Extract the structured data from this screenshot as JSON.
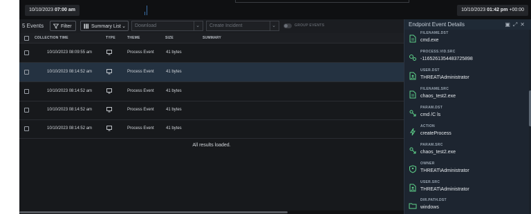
{
  "timeline": {
    "start_date": "10/10/2023",
    "start_time": "07:00 am",
    "end_date": "10/10/2023",
    "end_time": "01:42 pm",
    "end_tz": "+00:00"
  },
  "toolbar": {
    "count": "5 Events",
    "filter_label": "Filter",
    "view_label": "Summary List",
    "download_placeholder": "Download",
    "incident_placeholder": "Create Incident",
    "group_events_label": "GROUP EVENTS"
  },
  "table": {
    "columns": [
      "COLLECTION TIME",
      "TYPE",
      "THEME",
      "SIZE",
      "SUMMARY"
    ],
    "rows": [
      {
        "time": "10/10/2023 08:09:55 am",
        "theme": "Process Event",
        "size": "41 bytes"
      },
      {
        "time": "10/10/2023 08:14:52 am",
        "theme": "Process Event",
        "size": "41 bytes"
      },
      {
        "time": "10/10/2023 08:14:52 am",
        "theme": "Process Event",
        "size": "41 bytes"
      },
      {
        "time": "10/10/2023 08:14:52 am",
        "theme": "Process Event",
        "size": "41 bytes"
      },
      {
        "time": "10/10/2023 08:14:52 am",
        "theme": "Process Event",
        "size": "41 bytes"
      }
    ],
    "selected_row": 1,
    "status": "All results loaded."
  },
  "panel": {
    "title": "Endpoint Event Details",
    "properties": [
      {
        "key": "FILENAME.DST",
        "value": "cmd.exe",
        "icon": "file-icon"
      },
      {
        "key": "PROCESS.VID.SRC",
        "value": "-1165261354483725898",
        "icon": "gears-icon"
      },
      {
        "key": "USER.DST",
        "value": "THREAT\\Administrator",
        "icon": "user-file-icon"
      },
      {
        "key": "FILENAME.SRC",
        "value": "chaos_test2.exe",
        "icon": "file-icon"
      },
      {
        "key": "PARAM.DST",
        "value": "cmd /C ls",
        "icon": "param-icon"
      },
      {
        "key": "ACTION",
        "value": "createProcess",
        "icon": "bolt-icon"
      },
      {
        "key": "PARAM.SRC",
        "value": "chaos_test2.exe",
        "icon": "param-icon"
      },
      {
        "key": "OWNER",
        "value": "THREAT\\Administrator",
        "icon": "shield-icon"
      },
      {
        "key": "USER.SRC",
        "value": "THREAT\\Administrator",
        "icon": "user-file-icon"
      },
      {
        "key": "DIR.PATH.DST",
        "value": "windows",
        "icon": "folder-icon"
      }
    ]
  },
  "colors": {
    "accent_icon": "#5ed28a",
    "selected_row": "#243241",
    "panel_bg": "#1d2530"
  }
}
